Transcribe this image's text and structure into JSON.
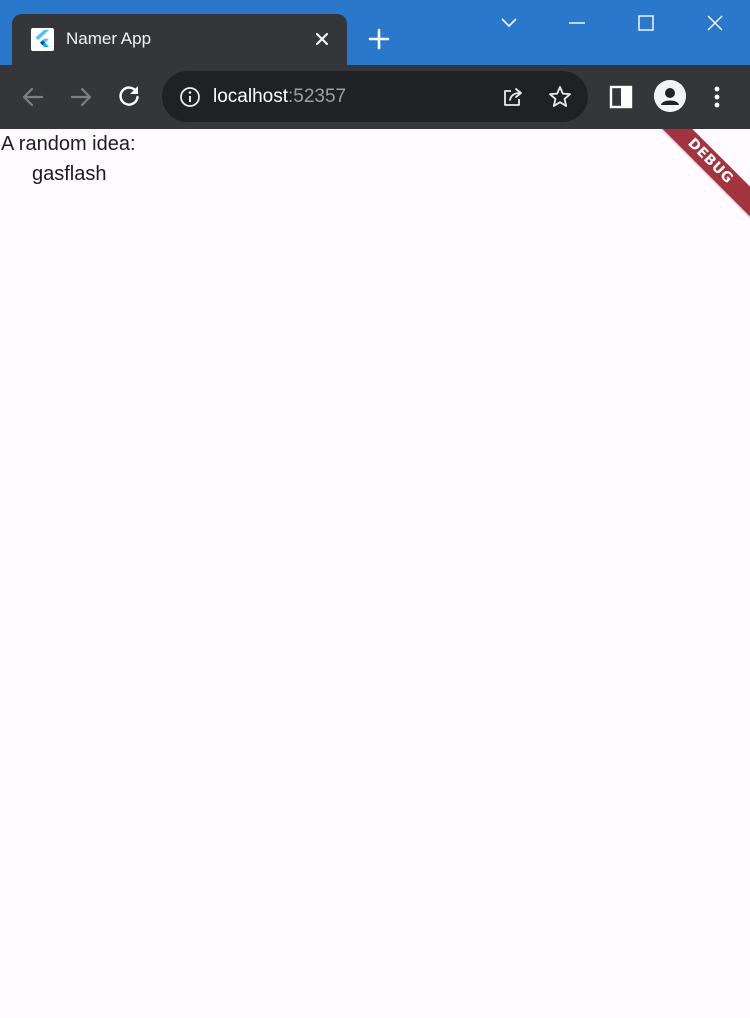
{
  "browser": {
    "tab": {
      "title": "Namer App",
      "favicon": "flutter-logo-icon",
      "close_icon": "close-icon"
    },
    "new_tab_icon": "plus-icon",
    "window_controls": [
      "chevron-down-icon",
      "minimize-icon",
      "maximize-icon",
      "close-icon"
    ],
    "toolbar": {
      "back_icon": "arrow-left-icon",
      "forward_icon": "arrow-right-icon",
      "reload_icon": "reload-icon",
      "url_host": "localhost",
      "url_port": ":52357",
      "site_info_icon": "info-icon",
      "share_icon": "share-icon",
      "bookmark_icon": "star-icon",
      "side_panel_icon": "side-panel-icon",
      "profile_icon": "avatar-icon",
      "menu_icon": "kebab-menu-icon"
    },
    "colors": {
      "titlebar": "#2a78cb",
      "tab_and_toolbar": "#35363a",
      "omnibox": "#202124",
      "page_background": "#fffbfe",
      "debug_banner": "#a3343f"
    }
  },
  "app": {
    "label": "A random idea:",
    "idea": "gasflash",
    "debug_banner": "DEBUG"
  }
}
